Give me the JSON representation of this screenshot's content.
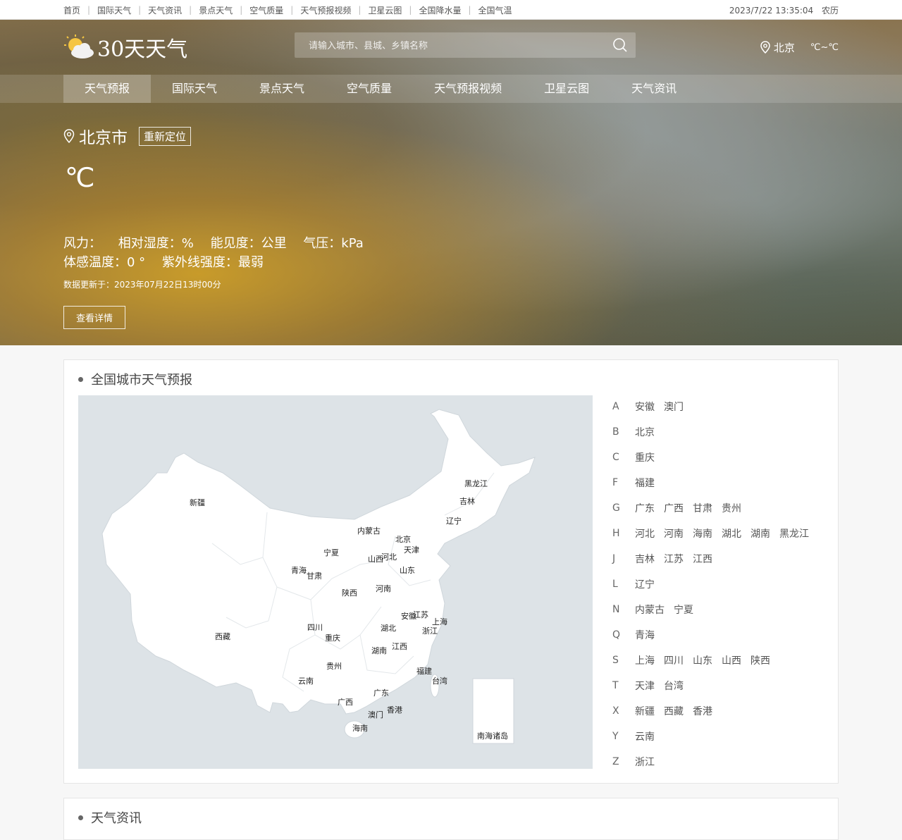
{
  "topbar": {
    "links": [
      "首页",
      "国际天气",
      "天气资讯",
      "景点天气",
      "空气质量",
      "天气预报视频",
      "卫星云图",
      "全国降水量",
      "全国气温"
    ],
    "datetime": "2023/7/22 13:35:04",
    "lunar": "农历"
  },
  "header": {
    "logo_text": "30天天气",
    "search_placeholder": "请输入城市、县城、乡镇名称",
    "location": "北京",
    "temp_unit": "℃~℃"
  },
  "nav": {
    "items": [
      "天气预报",
      "国际天气",
      "景点天气",
      "空气质量",
      "天气预报视频",
      "卫星云图",
      "天气资讯"
    ]
  },
  "weather": {
    "city": "北京市",
    "relocate": "重新定位",
    "temp": "℃",
    "wind": "风力：",
    "humidity": "相对湿度：%",
    "visibility": "能见度：公里",
    "pressure": "气压：kPa",
    "feels_like": "体感温度：0 °",
    "uv": "紫外线强度：最弱",
    "update": "数据更新于：2023年07月22日13时00分",
    "detail_button": "查看详情"
  },
  "city_panel": {
    "title": "全国城市天气预报",
    "map_labels": [
      "新疆",
      "西藏",
      "青海",
      "甘肃",
      "宁夏",
      "内蒙古",
      "黑龙江",
      "吉林",
      "辽宁",
      "北京",
      "天津",
      "河北",
      "山西",
      "山东",
      "陕西",
      "河南",
      "四川",
      "重庆",
      "湖北",
      "安徽",
      "江苏",
      "上海",
      "浙江",
      "湖南",
      "江西",
      "贵州",
      "云南",
      "福建",
      "台湾",
      "广东",
      "广西",
      "香港",
      "澳门",
      "海南",
      "南海诸岛"
    ],
    "letter_groups": [
      {
        "letter": "A",
        "cities": [
          "安徽",
          "澳门"
        ]
      },
      {
        "letter": "B",
        "cities": [
          "北京"
        ]
      },
      {
        "letter": "C",
        "cities": [
          "重庆"
        ]
      },
      {
        "letter": "F",
        "cities": [
          "福建"
        ]
      },
      {
        "letter": "G",
        "cities": [
          "广东",
          "广西",
          "甘肃",
          "贵州"
        ]
      },
      {
        "letter": "H",
        "cities": [
          "河北",
          "河南",
          "海南",
          "湖北",
          "湖南",
          "黑龙江"
        ]
      },
      {
        "letter": "J",
        "cities": [
          "吉林",
          "江苏",
          "江西"
        ]
      },
      {
        "letter": "L",
        "cities": [
          "辽宁"
        ]
      },
      {
        "letter": "N",
        "cities": [
          "内蒙古",
          "宁夏"
        ]
      },
      {
        "letter": "Q",
        "cities": [
          "青海"
        ]
      },
      {
        "letter": "S",
        "cities": [
          "上海",
          "四川",
          "山东",
          "山西",
          "陕西"
        ]
      },
      {
        "letter": "T",
        "cities": [
          "天津",
          "台湾"
        ]
      },
      {
        "letter": "X",
        "cities": [
          "新疆",
          "西藏",
          "香港"
        ]
      },
      {
        "letter": "Y",
        "cities": [
          "云南"
        ]
      },
      {
        "letter": "Z",
        "cities": [
          "浙江"
        ]
      }
    ]
  },
  "news_panel": {
    "title": "天气资讯"
  }
}
